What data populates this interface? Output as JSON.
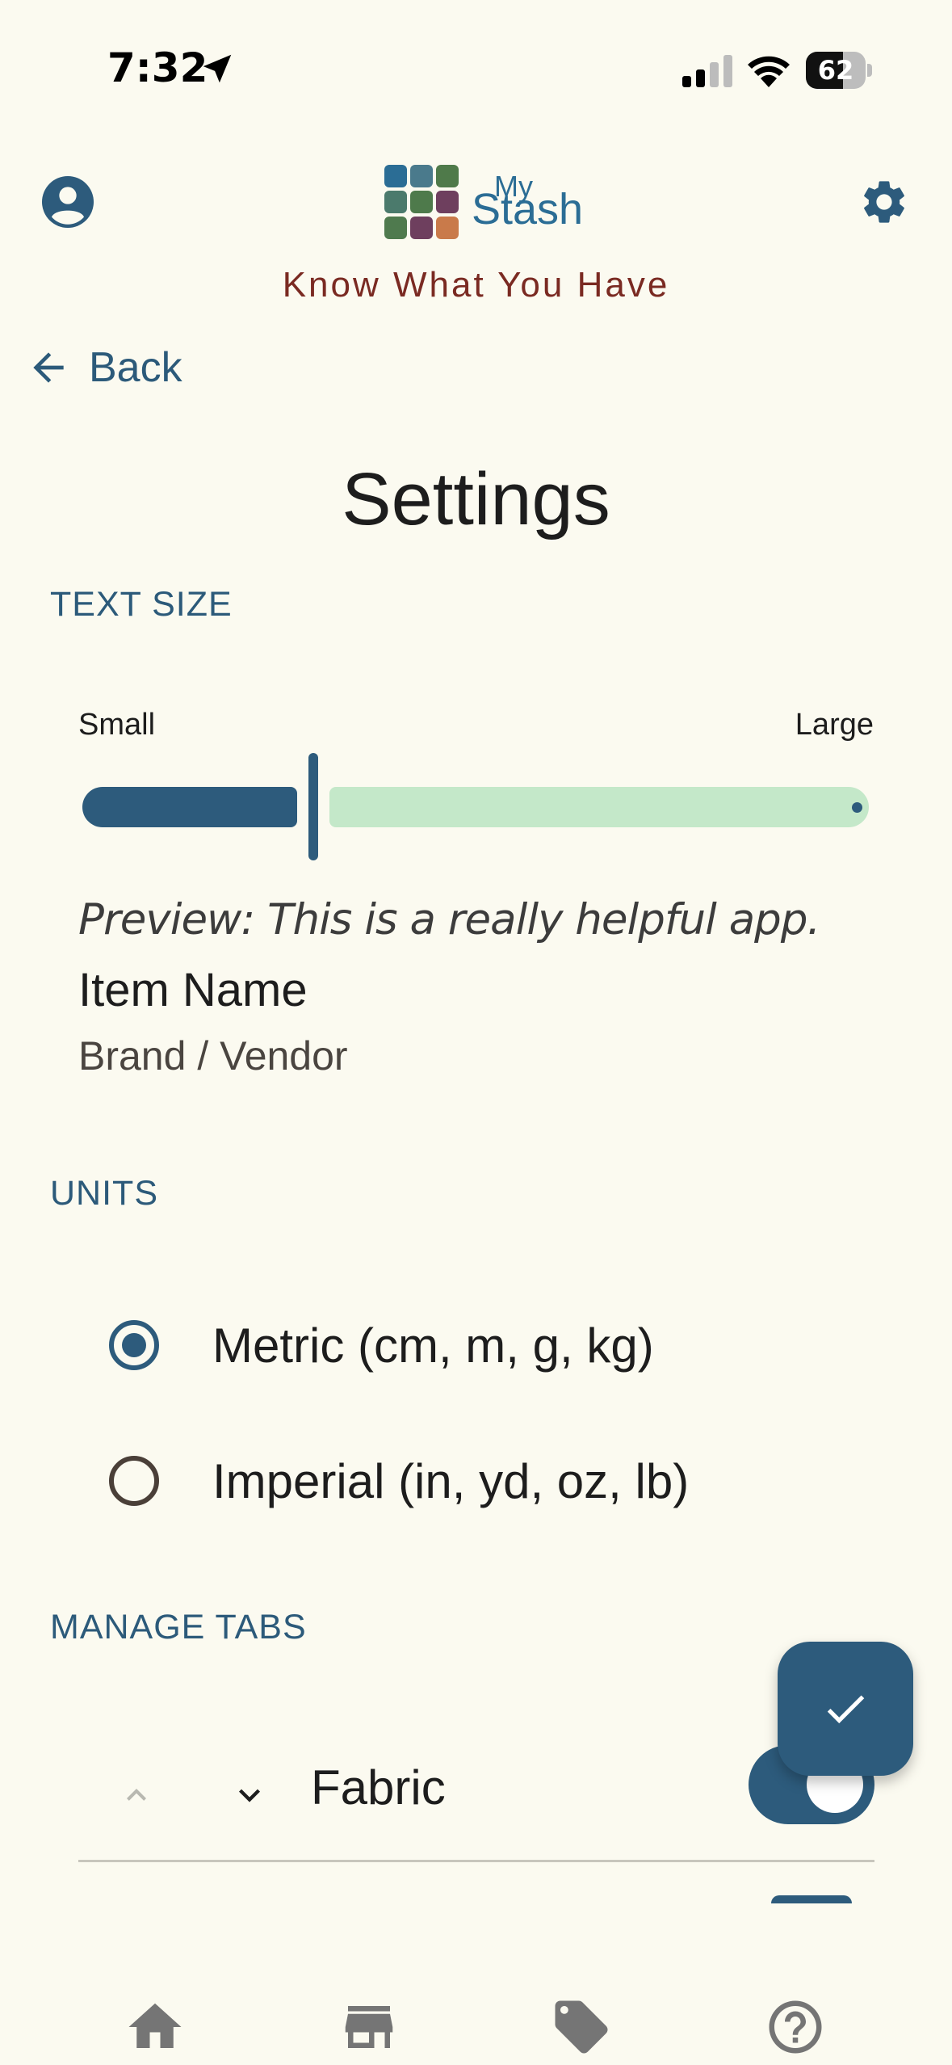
{
  "status_bar": {
    "time": "7:32",
    "battery": "62",
    "battery_level": 0.62
  },
  "header": {
    "logo_line1": "My",
    "logo_line2": "Stash",
    "tagline": "Know What You Have",
    "logo_colors": [
      "#2b6d95",
      "#4a7a8c",
      "#4f7a4a",
      "#4b7a6c",
      "#4e7a4b",
      "#6e3f5e",
      "#4f7a4e",
      "#6e3f5e",
      "#c97a4a"
    ]
  },
  "nav": {
    "back_label": "Back"
  },
  "page": {
    "title": "Settings"
  },
  "text_size": {
    "section_label": "TEXT SIZE",
    "min_label": "Small",
    "max_label": "Large",
    "value": 0.29,
    "preview_text": "Preview: This is a really helpful app.",
    "sample_item_name": "Item Name",
    "sample_brand": "Brand / Vendor"
  },
  "units": {
    "section_label": "UNITS",
    "options": [
      {
        "label": "Metric (cm, m, g, kg)",
        "selected": true
      },
      {
        "label": "Imperial (in, yd, oz, lb)",
        "selected": false
      }
    ]
  },
  "manage_tabs": {
    "section_label": "MANAGE TABS",
    "tabs": [
      {
        "label": "Fabric",
        "enabled": true
      }
    ]
  },
  "colors": {
    "accent": "#2d5b7c",
    "tagline": "#7a2a22",
    "background": "#fbfaf0",
    "slider_track": "#c4e8c9",
    "icon_gray": "#757575"
  },
  "bottom_nav": [
    "home-icon",
    "store-icon",
    "tag-icon",
    "help-icon"
  ]
}
